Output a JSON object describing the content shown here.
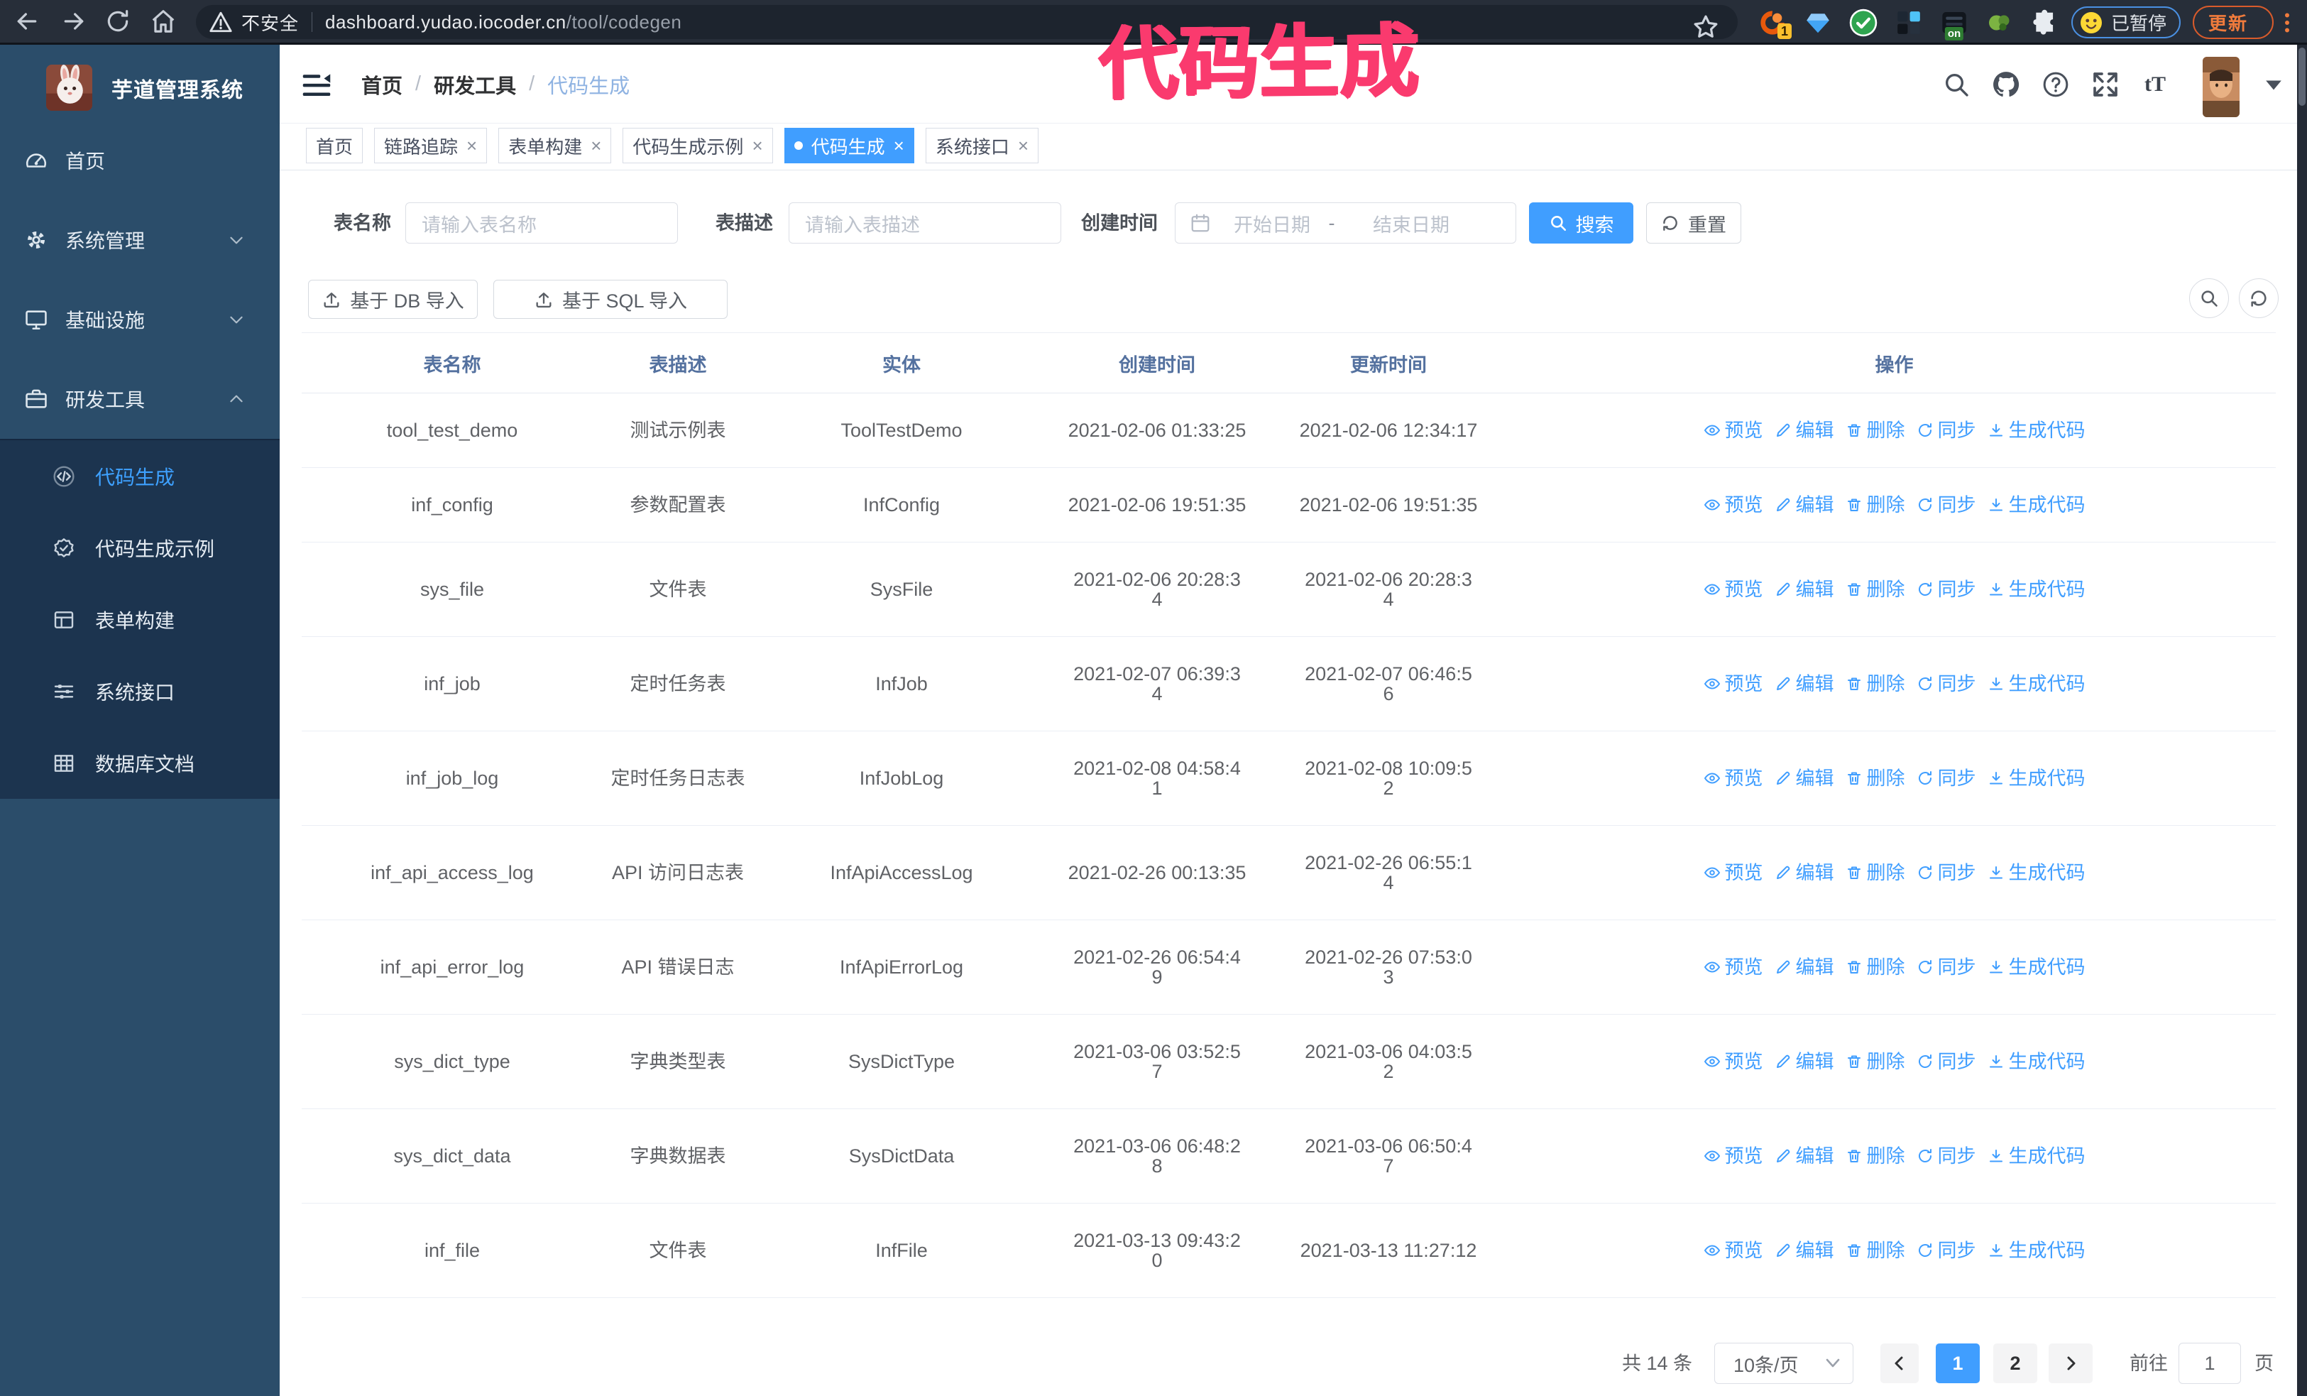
{
  "colors": {
    "accent": "#409eff",
    "sidebar_bg": "#2b4d6a",
    "submenu_bg": "#1c344f",
    "annotation": "#fa3a6e",
    "table_header_text": "#54719f",
    "chrome_bg": "#272e39"
  },
  "browser": {
    "security_label": "不安全",
    "url_host": "dashboard.yudao.iocoder.cn",
    "url_path": "/tool/codegen",
    "extension_badge_count": "1",
    "extension_on_badge": "on",
    "paused_pill_label": "已暂停",
    "update_button_label": "更新"
  },
  "annotation": {
    "text": "代码生成"
  },
  "sidebar": {
    "title": "芋道管理系统",
    "menu": [
      {
        "label": "首页",
        "icon": "dashboard-icon",
        "chevron": "",
        "active": false
      },
      {
        "label": "系统管理",
        "icon": "gear-icon",
        "chevron": "down",
        "active": false
      },
      {
        "label": "基础设施",
        "icon": "monitor-icon",
        "chevron": "down",
        "active": false
      },
      {
        "label": "研发工具",
        "icon": "briefcase-icon",
        "chevron": "up",
        "active": false
      }
    ],
    "submenu": [
      {
        "label": "代码生成",
        "icon": "code-icon",
        "active": true
      },
      {
        "label": "代码生成示例",
        "icon": "badge-check-icon",
        "active": false
      },
      {
        "label": "表单构建",
        "icon": "form-icon",
        "active": false
      },
      {
        "label": "系统接口",
        "icon": "sliders-icon",
        "active": false
      },
      {
        "label": "数据库文档",
        "icon": "database-table-icon",
        "active": false
      }
    ]
  },
  "navbar": {
    "breadcrumb": [
      "首页",
      "研发工具",
      "代码生成"
    ],
    "breadcrumb_separator": "/",
    "font_size_icon_text": "tT"
  },
  "tabs": [
    {
      "label": "首页",
      "closable": false,
      "active": false
    },
    {
      "label": "链路追踪",
      "closable": true,
      "active": false
    },
    {
      "label": "表单构建",
      "closable": true,
      "active": false
    },
    {
      "label": "代码生成示例",
      "closable": true,
      "active": false
    },
    {
      "label": "代码生成",
      "closable": true,
      "active": true
    },
    {
      "label": "系统接口",
      "closable": true,
      "active": false
    }
  ],
  "filters": {
    "table_name_label": "表名称",
    "table_name_placeholder": "请输入表名称",
    "table_desc_label": "表描述",
    "table_desc_placeholder": "请输入表描述",
    "create_time_label": "创建时间",
    "date_start_placeholder": "开始日期",
    "date_range_separator": "-",
    "date_end_placeholder": "结束日期",
    "search_label": "搜索",
    "reset_label": "重置"
  },
  "toolbar": {
    "import_db_label": "基于 DB 导入",
    "import_sql_label": "基于 SQL 导入"
  },
  "table": {
    "columns": [
      "表名称",
      "表描述",
      "实体",
      "创建时间",
      "更新时间",
      "操作"
    ],
    "op_labels": [
      "预览",
      "编辑",
      "删除",
      "同步",
      "生成代码"
    ],
    "op_icons": [
      "eye-icon",
      "edit-icon",
      "delete-icon",
      "sync-icon",
      "download-icon"
    ],
    "rows": [
      {
        "name": "tool_test_demo",
        "desc": "测试示例表",
        "entity": "ToolTestDemo",
        "create_time": "2021-02-06 01:33:25",
        "update_time": "2021-02-06 12:34:17"
      },
      {
        "name": "inf_config",
        "desc": "参数配置表",
        "entity": "InfConfig",
        "create_time": "2021-02-06 19:51:35",
        "update_time": "2021-02-06 19:51:35"
      },
      {
        "name": "sys_file",
        "desc": "文件表",
        "entity": "SysFile",
        "create_time": "2021-02-06 20:28:3\n4",
        "update_time": "2021-02-06 20:28:3\n4"
      },
      {
        "name": "inf_job",
        "desc": "定时任务表",
        "entity": "InfJob",
        "create_time": "2021-02-07 06:39:3\n4",
        "update_time": "2021-02-07 06:46:5\n6"
      },
      {
        "name": "inf_job_log",
        "desc": "定时任务日志表",
        "entity": "InfJobLog",
        "create_time": "2021-02-08 04:58:4\n1",
        "update_time": "2021-02-08 10:09:5\n2"
      },
      {
        "name": "inf_api_access_log",
        "desc": "API 访问日志表",
        "entity": "InfApiAccessLog",
        "create_time": "2021-02-26 00:13:35",
        "update_time": "2021-02-26 06:55:1\n4"
      },
      {
        "name": "inf_api_error_log",
        "desc": "API 错误日志",
        "entity": "InfApiErrorLog",
        "create_time": "2021-02-26 06:54:4\n9",
        "update_time": "2021-02-26 07:53:0\n3"
      },
      {
        "name": "sys_dict_type",
        "desc": "字典类型表",
        "entity": "SysDictType",
        "create_time": "2021-03-06 03:52:5\n7",
        "update_time": "2021-03-06 04:03:5\n2"
      },
      {
        "name": "sys_dict_data",
        "desc": "字典数据表",
        "entity": "SysDictData",
        "create_time": "2021-03-06 06:48:2\n8",
        "update_time": "2021-03-06 06:50:4\n7"
      },
      {
        "name": "inf_file",
        "desc": "文件表",
        "entity": "InfFile",
        "create_time": "2021-03-13 09:43:2\n0",
        "update_time": "2021-03-13 11:27:12"
      }
    ]
  },
  "pagination": {
    "total_label": "共 14 条",
    "page_size_label": "10条/页",
    "pages": [
      "1",
      "2"
    ],
    "active_page": "1",
    "goto_label": "前往",
    "goto_value": "1",
    "goto_suffix": "页"
  }
}
